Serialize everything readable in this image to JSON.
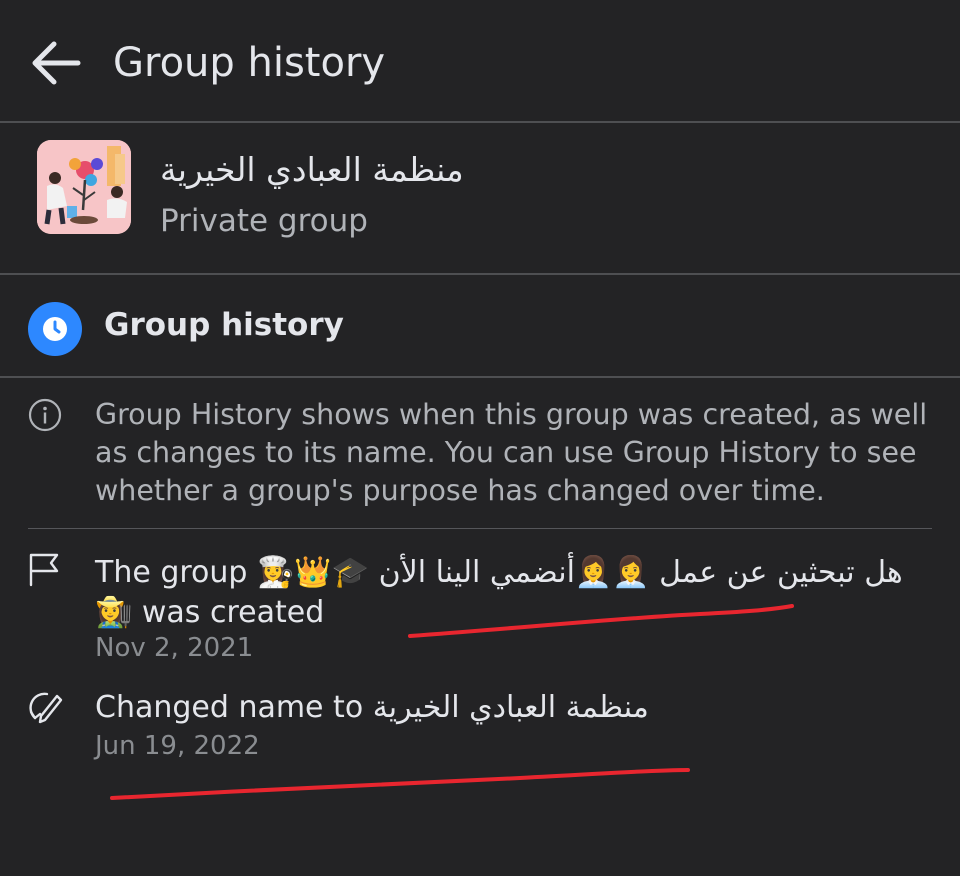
{
  "header": {
    "title": "Group history",
    "back_icon": "arrow-left-icon"
  },
  "group": {
    "name": "منظمة العبادي الخيرية",
    "type": "Private group",
    "avatar_icon": "group-avatar-image"
  },
  "section": {
    "title": "Group history",
    "icon": "clock-icon",
    "accent_color": "#2d88ff"
  },
  "info": {
    "icon": "info-icon",
    "text": "Group History shows when this group was created, as well as changes to its name. You can use Group History to see whether a group's purpose has changed over time."
  },
  "entries": [
    {
      "icon": "flag-icon",
      "prefix": "The group",
      "name": "هل تبحثين عن عمل 👩‍💼👩‍💼أنضمي الينا الأن 🎓👑👩‍🍳",
      "suffix": "👩‍🌾 was created",
      "date": "Nov 2, 2021"
    },
    {
      "icon": "edit-icon",
      "prefix": "Changed name to",
      "name": "منظمة العبادي الخيرية",
      "date": "Jun 19, 2022"
    }
  ],
  "colors": {
    "background": "#232325",
    "divider": "#4e4f52",
    "primary_text": "#e4e6eb",
    "secondary_text": "#b0b3b8",
    "annotation_red": "#e8262f"
  }
}
